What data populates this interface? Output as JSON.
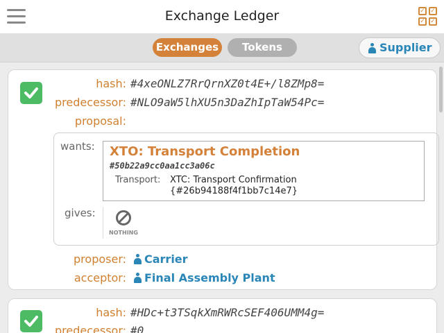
{
  "header": {
    "title": "Exchange Ledger",
    "menu_icon": "hamburger-menu-icon",
    "checklist_icon": "checklist-grid-icon",
    "checklist_color": "#d08a3a"
  },
  "toolbar": {
    "tabs": [
      {
        "label": "Exchanges",
        "active": true
      },
      {
        "label": "Tokens",
        "active": false
      }
    ],
    "role_button": {
      "label": "Supplier",
      "icon": "person-icon"
    }
  },
  "colors": {
    "accent_orange": "#d4813a",
    "link_blue": "#2b86b8",
    "status_green": "#4dbb63"
  },
  "exchanges": [
    {
      "status_icon": "check-icon",
      "hash_label": "hash:",
      "hash": "#4xeONLZ7RrQrnXZ0t4E+/l8ZMp8=",
      "predecessor_label": "predecessor:",
      "predecessor": "#NLO9aW5lhXU5n3DaZhIpTaW54Pc=",
      "proposal_label": "proposal:",
      "wants_label": "wants:",
      "wants": {
        "title": "XTO: Transport Completion",
        "hash": "#50b22a9cc0aa1cc3a06c",
        "field_label": "Transport:",
        "field_value": "XTC: Transport Confirmation",
        "field_hash": "{#26b94188f4f1bb7c14e7}"
      },
      "gives_label": "gives:",
      "gives": {
        "icon": "nothing-icon",
        "label": "NOTHING"
      },
      "proposer_label": "proposer:",
      "proposer": "Carrier",
      "acceptor_label": "acceptor:",
      "acceptor": "Final Assembly Plant"
    },
    {
      "status_icon": "check-icon",
      "hash_label": "hash:",
      "hash": "#HDc+t3TSqkXmRWRcSEF406UMM4g=",
      "predecessor_label": "predecessor:",
      "predecessor": "#0"
    }
  ]
}
